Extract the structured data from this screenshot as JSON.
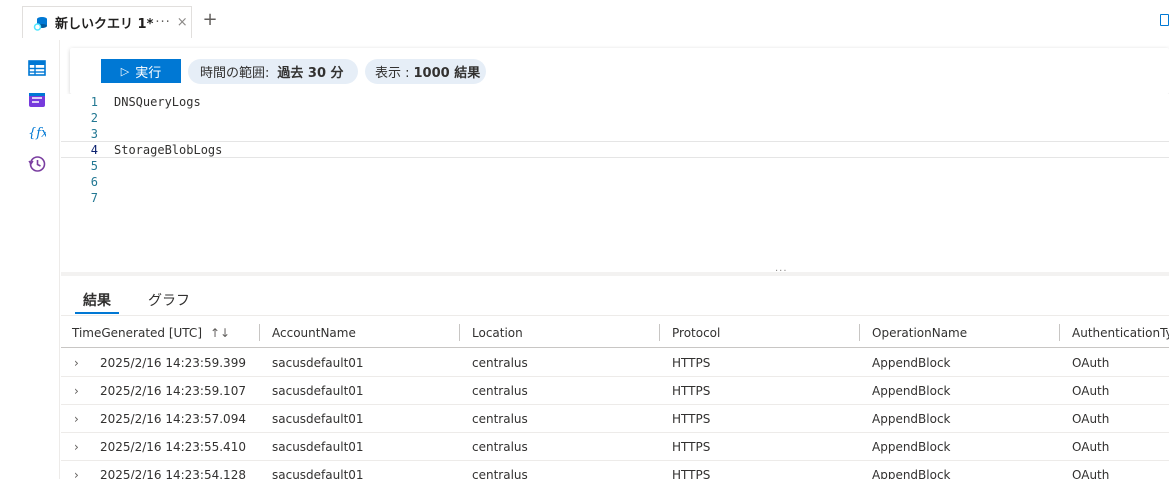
{
  "tab": {
    "title": "新しいクエリ 1*",
    "overflow": "···",
    "close": "×",
    "add": "+"
  },
  "toolbar": {
    "run_label": "実行",
    "run_glyph": "▷",
    "time_range_label": "時間の範囲:",
    "time_range_value": "過去 30 分",
    "limit_label": "表示 :",
    "limit_value": "1000 結果"
  },
  "editor": {
    "lines": [
      {
        "number": "1",
        "text": "DNSQueryLogs"
      },
      {
        "number": "2",
        "text": ""
      },
      {
        "number": "3",
        "text": ""
      },
      {
        "number": "4",
        "text": "StorageBlobLogs"
      },
      {
        "number": "5",
        "text": ""
      },
      {
        "number": "6",
        "text": ""
      },
      {
        "number": "7",
        "text": ""
      }
    ],
    "active_line": "4"
  },
  "splitter_glyph": "···",
  "result_tabs": {
    "results": "結果",
    "chart": "グラフ"
  },
  "grid": {
    "columns": [
      "TimeGenerated [UTC]",
      "AccountName",
      "Location",
      "Protocol",
      "OperationName",
      "AuthenticationTyp"
    ],
    "sort_glyph": "↑↓",
    "expand_glyph": "›",
    "rows": [
      [
        "2025/2/16 14:23:59.399",
        "sacusdefault01",
        "centralus",
        "HTTPS",
        "AppendBlock",
        "OAuth"
      ],
      [
        "2025/2/16 14:23:59.107",
        "sacusdefault01",
        "centralus",
        "HTTPS",
        "AppendBlock",
        "OAuth"
      ],
      [
        "2025/2/16 14:23:57.094",
        "sacusdefault01",
        "centralus",
        "HTTPS",
        "AppendBlock",
        "OAuth"
      ],
      [
        "2025/2/16 14:23:55.410",
        "sacusdefault01",
        "centralus",
        "HTTPS",
        "AppendBlock",
        "OAuth"
      ],
      [
        "2025/2/16 14:23:54.128",
        "sacusdefault01",
        "centralus",
        "HTTPS",
        "AppendBlock",
        "OAuth"
      ]
    ]
  },
  "colors": {
    "accent": "#0078d4",
    "pill_bg": "#e6eef7",
    "line_number": "#237893",
    "rail_icon": "#0078d4",
    "history_icon": "#7a3ea0"
  },
  "icons": {
    "tab": "query-database-icon",
    "rail": [
      "tables-icon",
      "queries-icon",
      "functions-icon",
      "query-history-icon"
    ],
    "tabbar_right": "save-icon"
  }
}
